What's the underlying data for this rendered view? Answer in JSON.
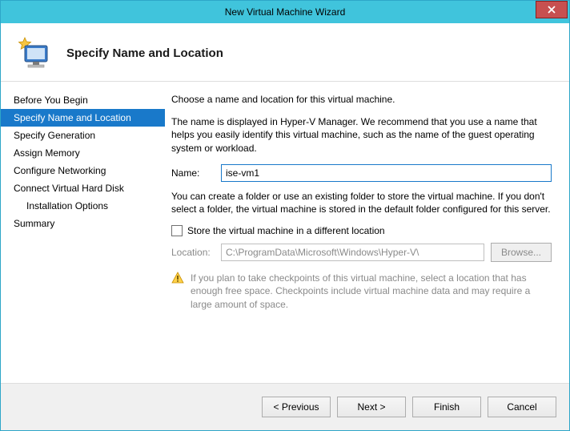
{
  "window": {
    "title": "New Virtual Machine Wizard"
  },
  "header": {
    "title": "Specify Name and Location"
  },
  "sidebar": {
    "steps": [
      {
        "label": "Before You Begin"
      },
      {
        "label": "Specify Name and Location"
      },
      {
        "label": "Specify Generation"
      },
      {
        "label": "Assign Memory"
      },
      {
        "label": "Configure Networking"
      },
      {
        "label": "Connect Virtual Hard Disk"
      },
      {
        "label": "Installation Options"
      },
      {
        "label": "Summary"
      }
    ]
  },
  "main": {
    "intro": "Choose a name and location for this virtual machine.",
    "nameHelp": "The name is displayed in Hyper-V Manager. We recommend that you use a name that helps you easily identify this virtual machine, such as the name of the guest operating system or workload.",
    "nameLabel": "Name:",
    "nameValue": "ise-vm1",
    "folderHelp": "You can create a folder or use an existing folder to store the virtual machine. If you don't select a folder, the virtual machine is stored in the default folder configured for this server.",
    "storeCheckboxLabel": "Store the virtual machine in a different location",
    "locationLabel": "Location:",
    "locationValue": "C:\\ProgramData\\Microsoft\\Windows\\Hyper-V\\",
    "browseLabel": "Browse...",
    "warning": "If you plan to take checkpoints of this virtual machine, select a location that has enough free space. Checkpoints include virtual machine data and may require a large amount of space."
  },
  "footer": {
    "previous": "< Previous",
    "next": "Next >",
    "finish": "Finish",
    "cancel": "Cancel"
  }
}
